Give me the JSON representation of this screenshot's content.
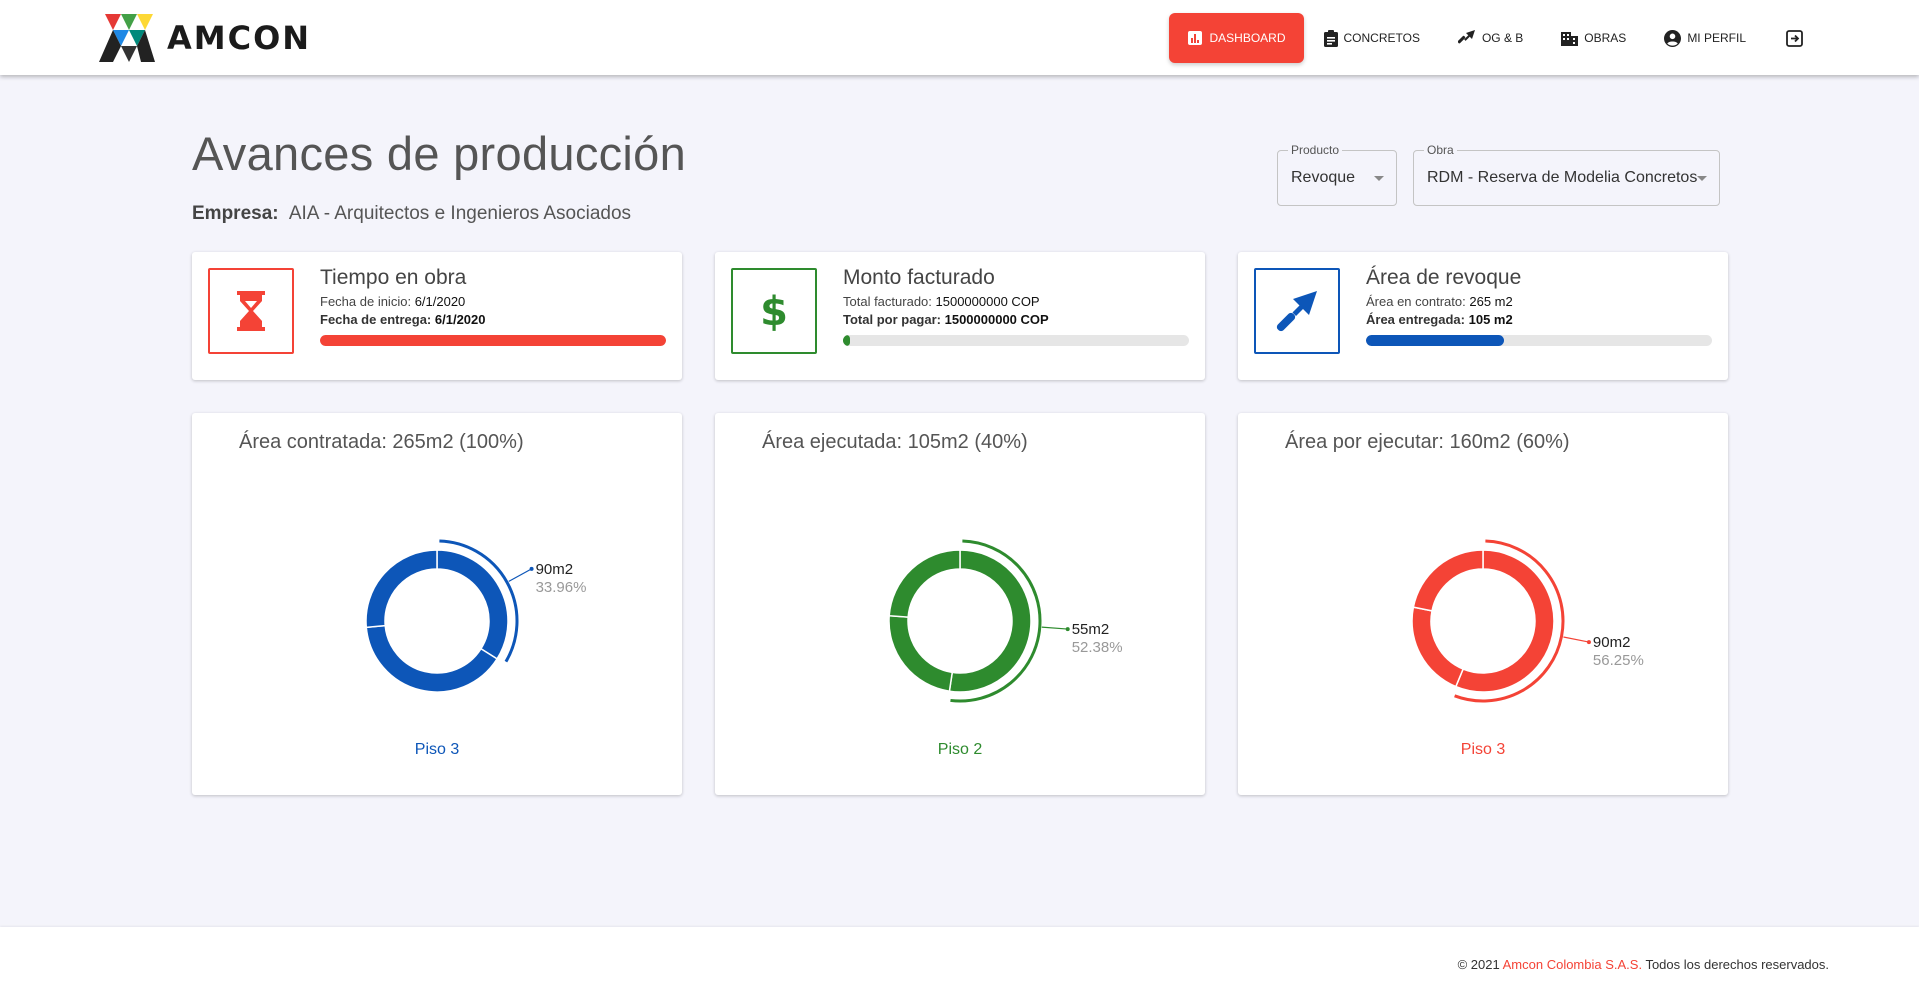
{
  "app": {
    "brand": "AMCON"
  },
  "nav": {
    "items": [
      {
        "label": "DASHBOARD",
        "icon": "bar-chart-icon"
      },
      {
        "label": "CONCRETOS",
        "icon": "clipboard-icon"
      },
      {
        "label": "OG & B",
        "icon": "trowel-icon"
      },
      {
        "label": "OBRAS",
        "icon": "building-icon"
      },
      {
        "label": "MI PERFIL",
        "icon": "account-circle-icon"
      }
    ],
    "logout_icon": "logout-icon",
    "active": "DASHBOARD"
  },
  "page": {
    "title": "Avances de producción",
    "company_label": "Empresa:",
    "company_value": "AIA - Arquitectos e Ingenieros Asociados"
  },
  "filters": {
    "producto": {
      "label": "Producto",
      "value": "Revoque"
    },
    "obra": {
      "label": "Obra",
      "value": "RDM - Reserva de Modelia Concretos"
    }
  },
  "stats": [
    {
      "title": "Tiempo en obra",
      "icon": "hourglass-icon",
      "color": "#f44336",
      "line1_label": "Fecha de inicio:",
      "line1_value": "6/1/2020",
      "line2_label": "Fecha de entrega:",
      "line2_value": "6/1/2020",
      "progress": 1.0
    },
    {
      "title": "Monto facturado",
      "icon": "dollar-icon",
      "color": "#2e8b2e",
      "line1_label": "Total facturado:",
      "line1_value": "1500000000 COP",
      "line2_label": "Total por pagar:",
      "line2_value": "1500000000 COP",
      "progress": 0.02
    },
    {
      "title": "Área de revoque",
      "icon": "trowel-icon",
      "color": "#0d56b8",
      "line1_label": "Área en contrato:",
      "line1_value": "265 m2",
      "line2_label": "Área entregada:",
      "line2_value": "105 m2",
      "progress": 0.4
    }
  ],
  "chart_data": [
    {
      "type": "pie",
      "title": "Área contratada: 265m2 (100%)",
      "color": "#0d56b8",
      "slices": [
        {
          "label": "90m2",
          "percent": "33.96%",
          "value": 90,
          "fraction": 0.3396,
          "highlighted": true
        },
        {
          "label": "",
          "value": 105,
          "fraction": 0.3962
        },
        {
          "label": "",
          "value": 70,
          "fraction": 0.2642
        }
      ],
      "footer": "Piso 3"
    },
    {
      "type": "pie",
      "title": "Área ejecutada: 105m2 (40%)",
      "color": "#2e8b2e",
      "slices": [
        {
          "label": "55m2",
          "percent": "52.38%",
          "value": 55,
          "fraction": 0.5238,
          "highlighted": true
        },
        {
          "label": "",
          "value": 25,
          "fraction": 0.2381
        },
        {
          "label": "",
          "value": 25,
          "fraction": 0.2381
        }
      ],
      "footer": "Piso 2"
    },
    {
      "type": "pie",
      "title": "Área por ejecutar: 160m2 (60%)",
      "color": "#f44336",
      "slices": [
        {
          "label": "90m2",
          "percent": "56.25%",
          "value": 90,
          "fraction": 0.5625,
          "highlighted": true
        },
        {
          "label": "",
          "value": 35,
          "fraction": 0.2188
        },
        {
          "label": "",
          "value": 35,
          "fraction": 0.2187
        }
      ],
      "footer": "Piso 3"
    }
  ],
  "footer": {
    "prefix": "© 2021 ",
    "brand": "Amcon Colombia S.A.S.",
    "suffix": " Todos los derechos reservados."
  }
}
